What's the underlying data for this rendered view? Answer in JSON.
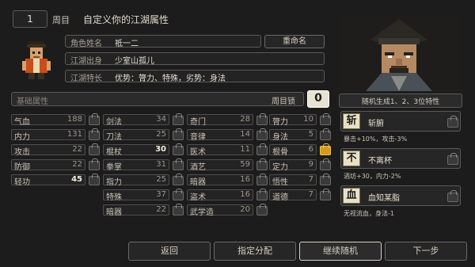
{
  "header": {
    "round_value": "1",
    "round_label": "周目",
    "title": "自定义你的江湖属性"
  },
  "profile": {
    "name_label": "角色姓名",
    "name_value": "祗一二",
    "rename_button": "重命名",
    "origin_label": "江湖出身",
    "origin_value": "少室山孤儿",
    "trait_label": "江湖特长",
    "trait_value": "优势：膂力、特殊，劣势：身法"
  },
  "attributes": {
    "section_label": "基础属性",
    "lock_label": "周目锁",
    "lock_count": "0",
    "columns": [
      [
        {
          "name": "气血",
          "value": "188",
          "locked": false
        },
        {
          "name": "内力",
          "value": "131",
          "locked": false
        },
        {
          "name": "攻击",
          "value": "22",
          "locked": false
        },
        {
          "name": "防御",
          "value": "22",
          "locked": false
        },
        {
          "name": "轻功",
          "value": "45",
          "locked": false,
          "highlight": true
        }
      ],
      [
        {
          "name": "剑法",
          "value": "34",
          "locked": false
        },
        {
          "name": "刀法",
          "value": "25",
          "locked": false
        },
        {
          "name": "棍杖",
          "value": "30",
          "locked": false,
          "highlight": true
        },
        {
          "name": "拳掌",
          "value": "31",
          "locked": false
        },
        {
          "name": "指力",
          "value": "25",
          "locked": false
        },
        {
          "name": "特殊",
          "value": "37",
          "locked": false
        },
        {
          "name": "暗器",
          "value": "22",
          "locked": false
        }
      ],
      [
        {
          "name": "奇门",
          "value": "28",
          "locked": false
        },
        {
          "name": "音律",
          "value": "14",
          "locked": false
        },
        {
          "name": "医术",
          "value": "11",
          "locked": false
        },
        {
          "name": "酒艺",
          "value": "59",
          "locked": false
        },
        {
          "name": "暗器",
          "value": "16",
          "locked": false
        },
        {
          "name": "盗术",
          "value": "16",
          "locked": false
        },
        {
          "name": "武学造",
          "value": "20",
          "locked": false
        }
      ],
      [
        {
          "name": "膂力",
          "value": "10",
          "locked": false
        },
        {
          "name": "身法",
          "value": "5",
          "locked": false
        },
        {
          "name": "根骨",
          "value": "6",
          "locked": true
        },
        {
          "name": "定力",
          "value": "9",
          "locked": false
        },
        {
          "name": "悟性",
          "value": "7",
          "locked": false
        },
        {
          "name": "道德",
          "value": "7",
          "locked": false
        }
      ]
    ]
  },
  "traits_panel": {
    "header": "随机生成1、2、3位特性",
    "items": [
      {
        "glyph": "斩",
        "name": "斩腑",
        "desc": "暴击+10%，攻击-3%"
      },
      {
        "glyph": "不",
        "name": "不离杯",
        "desc": "酒坊+30，内力-2%"
      },
      {
        "glyph": "血",
        "name": "血知某脂",
        "desc": "无视流血，身法-1"
      }
    ]
  },
  "footer": {
    "back": "返回",
    "assign": "指定分配",
    "reroll": "继续随机",
    "next": "下一步"
  }
}
